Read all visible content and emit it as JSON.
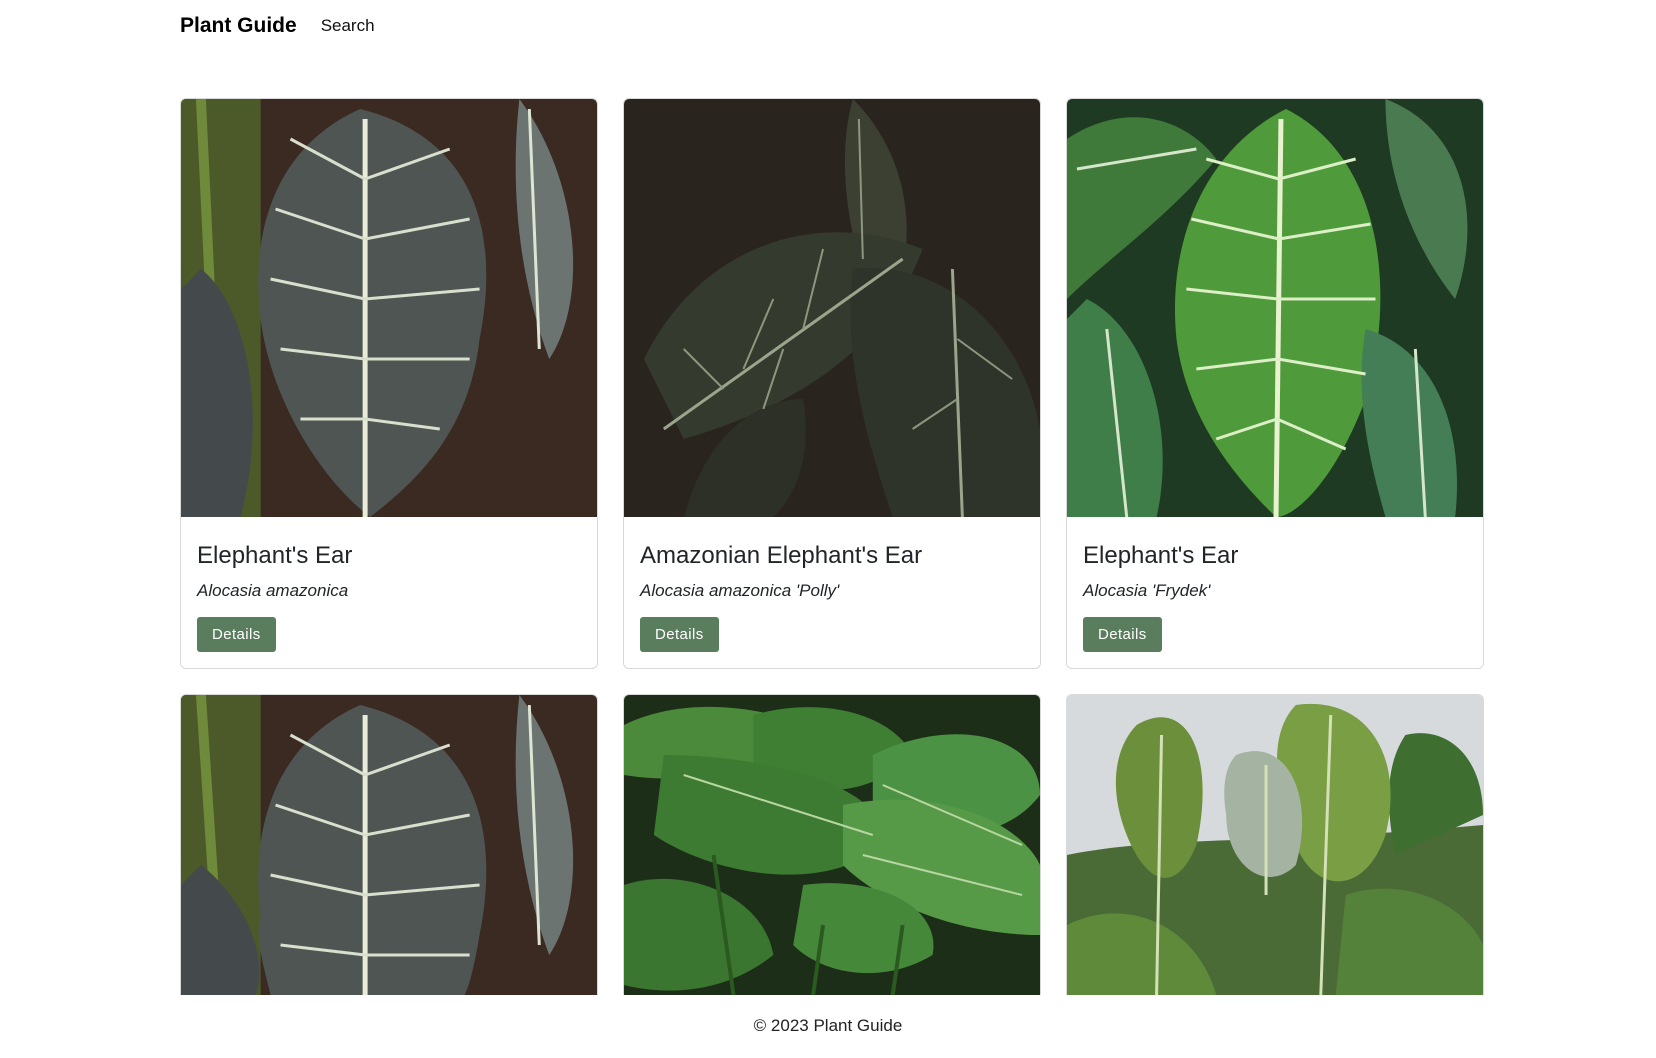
{
  "navbar": {
    "brand": "Plant Guide",
    "links": [
      "Search"
    ]
  },
  "plants": [
    {
      "common_name": "Elephant's Ear",
      "scientific_name": "Alocasia amazonica",
      "button": "Details",
      "image": "dark-silver-veined-leaf"
    },
    {
      "common_name": "Amazonian Elephant's Ear",
      "scientific_name": "Alocasia amazonica 'Polly'",
      "button": "Details",
      "image": "dark-green-polly-leaves"
    },
    {
      "common_name": "Elephant's Ear",
      "scientific_name": "Alocasia 'Frydek'",
      "button": "Details",
      "image": "bright-green-velvet-leaf"
    },
    {
      "image": "dark-silver-veined-leaf"
    },
    {
      "image": "large-green-leaves-jungle"
    },
    {
      "image": "tall-green-leaves-sky"
    }
  ],
  "colors": {
    "button": "#5a7d5e",
    "card_border": "rgba(0,0,0,0.15)"
  },
  "footer": {
    "copyright": "© 2023 Plant Guide"
  }
}
